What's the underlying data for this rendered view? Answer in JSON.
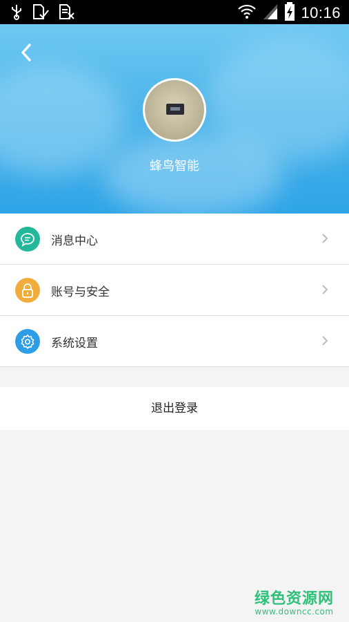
{
  "status_bar": {
    "time": "10:16",
    "left_icons": [
      "usb-icon",
      "sim-check-icon",
      "sim-off-icon"
    ],
    "right_icons": [
      "wifi-icon",
      "signal-icon",
      "battery-charging-icon"
    ]
  },
  "header": {
    "back_icon": "chevron-left-icon",
    "avatar_icon": "avatar",
    "username": "蜂鸟智能"
  },
  "menu": {
    "items": [
      {
        "label": "消息中心",
        "icon": "message-icon",
        "color": "#23b79c"
      },
      {
        "label": "账号与安全",
        "icon": "lock-icon",
        "color": "#f0ad3c"
      },
      {
        "label": "系统设置",
        "icon": "gear-icon",
        "color": "#2d9ee6"
      }
    ]
  },
  "logout": {
    "label": "退出登录"
  },
  "watermark": {
    "line1": "绿色资源网",
    "line2": "www.downcc.com"
  }
}
